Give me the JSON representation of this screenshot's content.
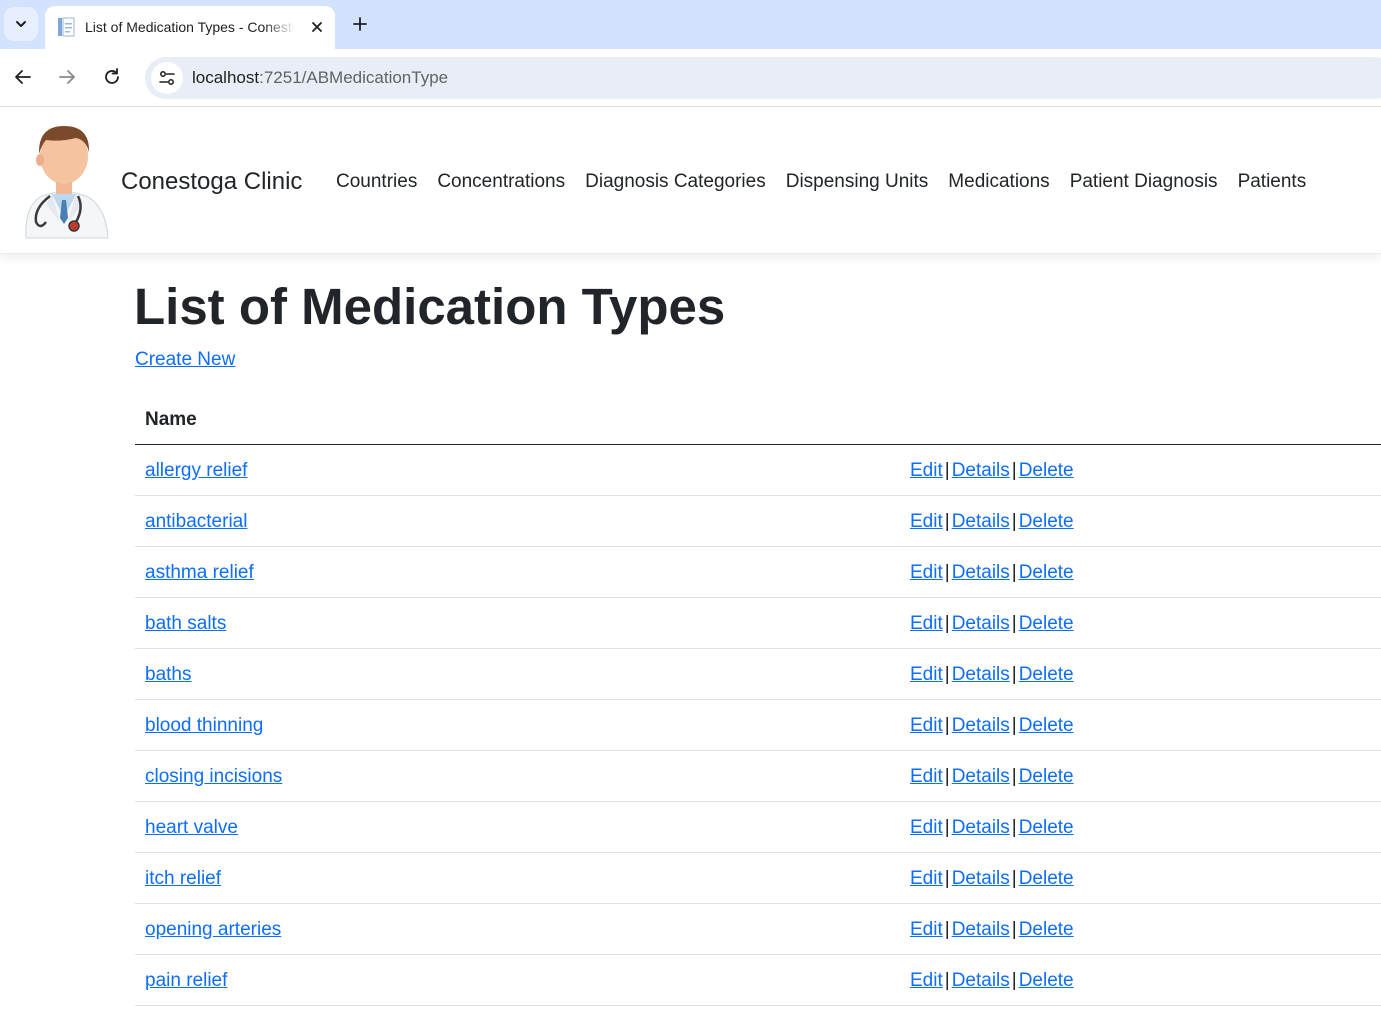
{
  "browser": {
    "tab_title": "List of Medication Types - Conestoga Clinic",
    "url_host": "localhost",
    "url_path": ":7251/ABMedicationType"
  },
  "site": {
    "brand": "Conestoga Clinic",
    "nav_items": [
      "Countries",
      "Concentrations",
      "Diagnosis Categories",
      "Dispensing Units",
      "Medications",
      "Patient Diagnosis",
      "Patients"
    ]
  },
  "main": {
    "title": "List of Medication Types",
    "create_new": "Create New",
    "table": {
      "header_name": "Name",
      "rows": [
        {
          "name": "allergy relief"
        },
        {
          "name": "antibacterial"
        },
        {
          "name": "asthma relief"
        },
        {
          "name": "bath salts"
        },
        {
          "name": "baths"
        },
        {
          "name": "blood thinning"
        },
        {
          "name": "closing incisions"
        },
        {
          "name": "heart valve"
        },
        {
          "name": "itch relief"
        },
        {
          "name": "opening arteries"
        },
        {
          "name": "pain relief"
        }
      ],
      "actions": {
        "edit": "Edit",
        "details": "Details",
        "delete": "Delete",
        "separator": "|"
      }
    }
  },
  "colors": {
    "link": "#0d6efd",
    "text": "#212529",
    "tabstrip": "#d3e3fd"
  }
}
